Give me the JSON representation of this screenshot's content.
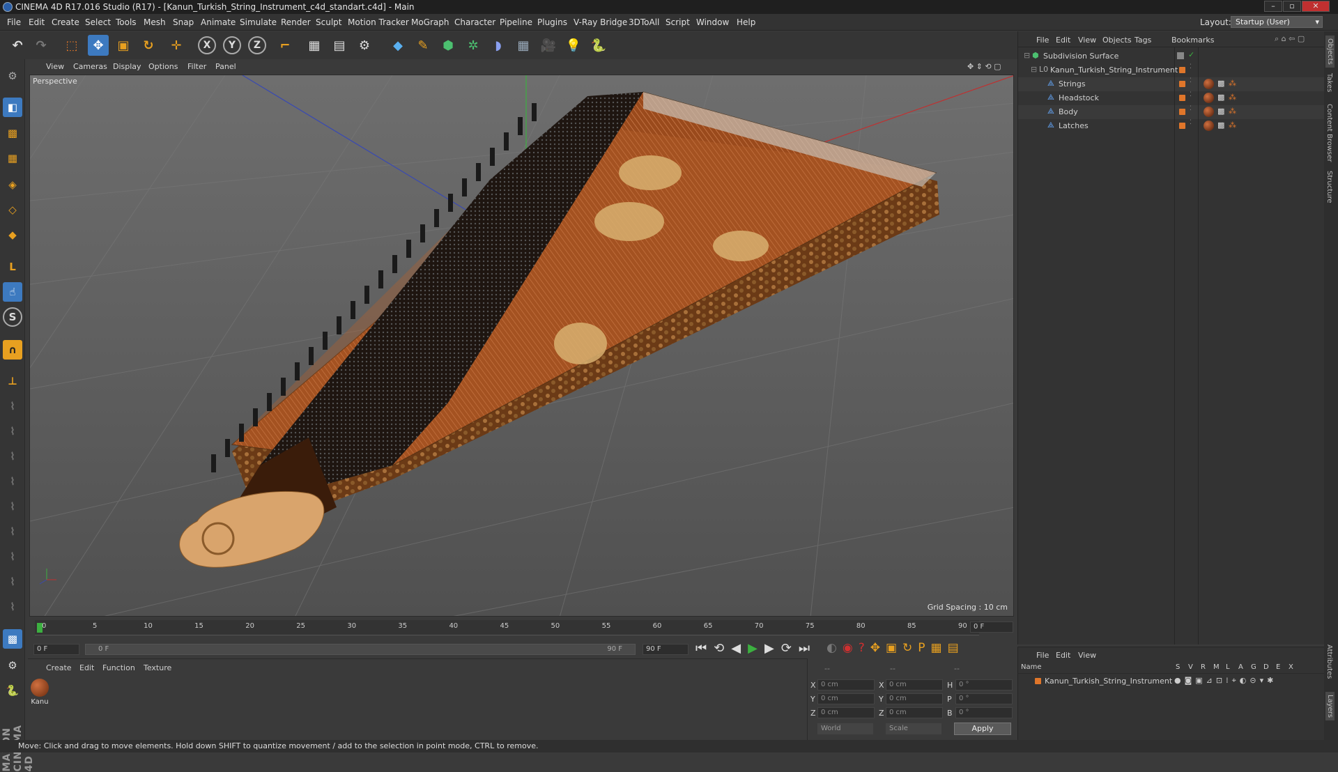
{
  "window": {
    "title": "CINEMA 4D R17.016 Studio (R17) - [Kanun_Turkish_String_Instrument_c4d_standart.c4d] - Main"
  },
  "menu": [
    "File",
    "Edit",
    "Create",
    "Select",
    "Tools",
    "Mesh",
    "Snap",
    "Animate",
    "Simulate",
    "Render",
    "Sculpt",
    "Motion Tracker",
    "MoGraph",
    "Character",
    "Pipeline",
    "Plugins",
    "V-Ray Bridge",
    "3DToAll",
    "Script",
    "Window",
    "Help"
  ],
  "layout": {
    "label": "Layout:",
    "value": "Startup (User)"
  },
  "viewport": {
    "menu": [
      "View",
      "Cameras",
      "Display",
      "Options",
      "Filter",
      "Panel"
    ],
    "label": "Perspective",
    "grid_spacing": "Grid Spacing : 10 cm"
  },
  "timeline": {
    "ticks": [
      "0",
      "5",
      "10",
      "15",
      "20",
      "25",
      "30",
      "35",
      "40",
      "45",
      "50",
      "55",
      "60",
      "65",
      "70",
      "75",
      "80",
      "85",
      "90"
    ],
    "current_frame": "0 F",
    "start": "0 F",
    "range_start": "0 F",
    "range_end": "90 F",
    "end": "90 F"
  },
  "material_panel": {
    "menu": [
      "Create",
      "Edit",
      "Function",
      "Texture"
    ],
    "materials": [
      {
        "name": "Kanu"
      }
    ]
  },
  "coords": {
    "headers": [
      "--",
      "--",
      "--"
    ],
    "rows": [
      {
        "a": "X",
        "av": "0 cm",
        "b": "X",
        "bv": "0 cm",
        "c": "H",
        "cv": "0 °"
      },
      {
        "a": "Y",
        "av": "0 cm",
        "b": "Y",
        "bv": "0 cm",
        "c": "P",
        "cv": "0 °"
      },
      {
        "a": "Z",
        "av": "0 cm",
        "b": "Z",
        "bv": "0 cm",
        "c": "B",
        "cv": "0 °"
      }
    ],
    "space": "World",
    "mode": "Scale",
    "apply": "Apply"
  },
  "object_manager": {
    "menu": [
      "File",
      "Edit",
      "View",
      "Objects",
      "Tags",
      "Bookmarks"
    ],
    "objects": [
      {
        "name": "Subdivision Surface",
        "level": 0
      },
      {
        "name": "Kanun_Turkish_String_Instrument",
        "level": 1
      },
      {
        "name": "Strings",
        "level": 2
      },
      {
        "name": "Headstock",
        "level": 2
      },
      {
        "name": "Body",
        "level": 2
      },
      {
        "name": "Latches",
        "level": 2
      }
    ]
  },
  "layer_manager": {
    "menu": [
      "File",
      "Edit",
      "View"
    ],
    "columns": [
      "Name",
      "S",
      "V",
      "R",
      "M",
      "L",
      "A",
      "G",
      "D",
      "E",
      "X"
    ],
    "layers": [
      {
        "name": "Kanun_Turkish_String_Instrument"
      }
    ]
  },
  "right_tabs": [
    "Objects",
    "Takes",
    "Content Browser",
    "Structure",
    "Attributes",
    "Layers"
  ],
  "branding": "MAXON CINEMA 4D",
  "status": "Move: Click and drag to move elements. Hold down SHIFT to quantize movement / add to the selection in point mode, CTRL to remove.",
  "colors": {
    "accent": "#e0762a",
    "active_blue": "#3d7ac0",
    "bg": "#3a3a3a"
  }
}
